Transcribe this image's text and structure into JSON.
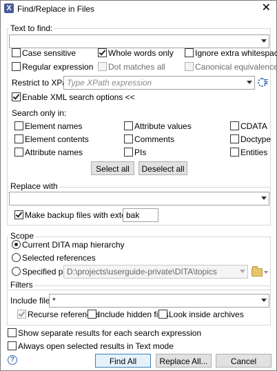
{
  "window": {
    "title": "Find/Replace in Files",
    "close_symbol": "✕"
  },
  "text_to_find": {
    "group_title": "Text to find:",
    "value": "",
    "options": {
      "case_sensitive": {
        "label": "Case sensitive",
        "checked": false
      },
      "whole_words_only": {
        "label": "Whole words only",
        "checked": true
      },
      "ignore_extra_whitespaces": {
        "label": "Ignore extra whitespaces",
        "checked": false,
        "enabled": true
      },
      "regular_expression": {
        "label": "Regular expression",
        "checked": false
      },
      "dot_matches_all": {
        "label": "Dot matches all",
        "checked": false,
        "enabled": false
      },
      "canonical_equivalence": {
        "label": "Canonical equivalence",
        "checked": false,
        "enabled": false
      }
    },
    "xpath_label": "Restrict to XPath:",
    "xpath_placeholder": "Type XPath expression",
    "enable_xml_search": {
      "label": "Enable XML search options <<",
      "checked": true
    },
    "search_only_in": {
      "label": "Search only in:",
      "items": [
        {
          "label": "Element names",
          "checked": false
        },
        {
          "label": "Attribute values",
          "checked": false
        },
        {
          "label": "CDATA",
          "checked": false
        },
        {
          "label": "Element contents",
          "checked": false
        },
        {
          "label": "Comments",
          "checked": false
        },
        {
          "label": "Doctype",
          "checked": false
        },
        {
          "label": "Attribute names",
          "checked": false
        },
        {
          "label": "PIs",
          "checked": false
        },
        {
          "label": "Entities",
          "checked": false
        }
      ]
    },
    "select_all_label": "Select all",
    "deselect_all_label": "Deselect all"
  },
  "replace_with": {
    "group_title": "Replace with",
    "value": "",
    "backup": {
      "label": "Make backup files with extension:",
      "checked": true,
      "extension": "bak"
    }
  },
  "scope": {
    "group_title": "Scope",
    "current_dita_map": {
      "label": "Current DITA map hierarchy",
      "selected": true
    },
    "selected_references": {
      "label": "Selected references",
      "selected": false
    },
    "specified_path": {
      "label": "Specified path:",
      "selected": false,
      "value": "D:\\projects\\userguide-private\\DITA\\topics"
    }
  },
  "filters": {
    "group_title": "Filters",
    "include_files_label": "Include files:",
    "include_files_value": "*",
    "recurse_references": {
      "label": "Recurse references",
      "checked": true,
      "enabled": false
    },
    "include_hidden_files": {
      "label": "Include hidden files",
      "checked": false
    },
    "look_inside_archives": {
      "label": "Look inside archives",
      "checked": false
    }
  },
  "bottom_options": {
    "separate_results": {
      "label": "Show separate results for each search expression",
      "checked": false
    },
    "open_in_text_mode": {
      "label": "Always open selected results in Text mode",
      "checked": false
    }
  },
  "buttons": {
    "help_symbol": "?",
    "find_all": "Find All",
    "replace_all": "Replace All...",
    "cancel": "Cancel"
  }
}
